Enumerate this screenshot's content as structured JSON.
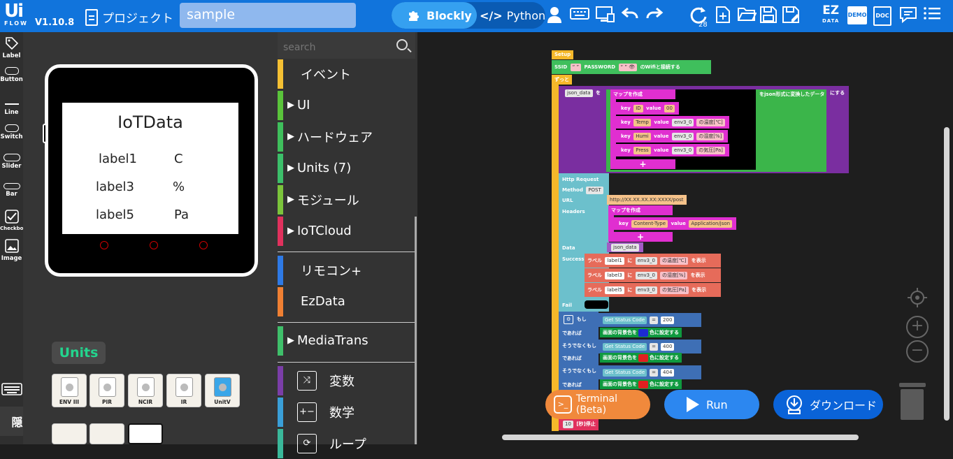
{
  "app": {
    "logo_ui": "Ui",
    "logo_flow": "FLOW",
    "version": "V1.10.8",
    "project_label": "プロジェクト",
    "project_name": "sample"
  },
  "mode": {
    "blockly_label": "Blockly",
    "python_label": "Python"
  },
  "toolbar_right": {
    "ez_label": "EZ",
    "ez_sub": "DATA",
    "demo_label": "DEMO",
    "doc_label": "DOC",
    "refresh_badge": "28"
  },
  "left_tools": [
    "Label",
    "Button",
    "Line",
    "Switch",
    "Slider",
    "Bar",
    "Checkbox",
    "Image"
  ],
  "hide_label": "隠す",
  "device": {
    "title": "IoTData",
    "labels": [
      {
        "name": "label1",
        "value": "C"
      },
      {
        "name": "label3",
        "value": "%"
      },
      {
        "name": "label5",
        "value": "Pa"
      }
    ]
  },
  "units": {
    "title": "Units",
    "cards": [
      "ENV III",
      "PIR",
      "NCIR",
      "IR",
      "UnitV"
    ]
  },
  "search": {
    "placeholder": "search"
  },
  "categories": [
    {
      "label": "イベント",
      "color": "#f5c033",
      "arrow": false
    },
    {
      "label": "UI",
      "color": "#5ac43b",
      "arrow": true
    },
    {
      "label": "ハードウェア",
      "color": "#3fbf5c",
      "arrow": true
    },
    {
      "label": "Units (7)",
      "color": "#3cbf6a",
      "arrow": true
    },
    {
      "label": "モジュール",
      "color": "#7bc43b",
      "arrow": true
    },
    {
      "label": "IoTCloud",
      "color": "#e0315d",
      "arrow": true
    },
    {
      "label": "リモコン+",
      "color": "#2e7ae6",
      "arrow": false
    },
    {
      "label": "EzData",
      "color": "#f08033",
      "arrow": false
    },
    {
      "label": "MediaTrans",
      "color": "#3fbf6a",
      "arrow": true
    },
    {
      "label": "変数",
      "color": "#7b3ea8",
      "symbol": "⤨"
    },
    {
      "label": "数学",
      "color": "#3a9fd8",
      "symbol": "+−"
    },
    {
      "label": "ループ",
      "color": "#3ab89a",
      "symbol": "⟳"
    }
  ],
  "blocks": {
    "setup": "Setup",
    "ssid": "SSID",
    "password": "PASSWORD",
    "wifi_connect": "のWifiと接続する",
    "forever": "ずっと",
    "json_var": "json_data",
    "assign": "を",
    "make_map": "マップを作成",
    "to_json": "をjson形式に変換したデータ",
    "to_json_end": "にする",
    "key": "key",
    "value": "value",
    "map_rows": [
      {
        "key": "ID",
        "value": "00",
        "suffix": ""
      },
      {
        "key": "Temp",
        "value": "env3_0",
        "suffix": "の温度[℃]"
      },
      {
        "key": "Humi",
        "value": "env3_0",
        "suffix": "の湿度[%]"
      },
      {
        "key": "Press",
        "value": "env3_0",
        "suffix": "の気圧[Pa]"
      }
    ],
    "http_request": "Http Request",
    "method": "Method",
    "method_value": "POST",
    "url": "URL",
    "url_value": "http://XX.XX.XX.XX:XXXX/post",
    "headers": "Headers",
    "header_key": "Content-Type",
    "header_value": "Application/json",
    "data": "Data",
    "success": "Success",
    "label_word": "ラベル",
    "ni": "に",
    "display": "を表示",
    "success_rows": [
      {
        "label": "label1",
        "value": "env3_0",
        "suffix": "の温度[℃]"
      },
      {
        "label": "label3",
        "value": "env3_0",
        "suffix": "の湿度[%]"
      },
      {
        "label": "label5",
        "value": "env3_0",
        "suffix": "の気圧[Pa]"
      }
    ],
    "fail": "Fail",
    "if": "もし",
    "then": "であれば",
    "elseif": "そうでなくもし",
    "status_code": "Get Status Code",
    "eq": "=",
    "codes": [
      "200",
      "400",
      "404"
    ],
    "bg_color": "画面の背景色を",
    "bg_suffix": "色に設定する",
    "bg_colors": [
      "#1d2bd1",
      "#e02020",
      "#e02020"
    ],
    "wait_value": "10",
    "wait_label": "[秒]停止"
  },
  "buttons": {
    "terminal": "Terminal (Beta)",
    "run": "Run",
    "download": "ダウンロード"
  }
}
